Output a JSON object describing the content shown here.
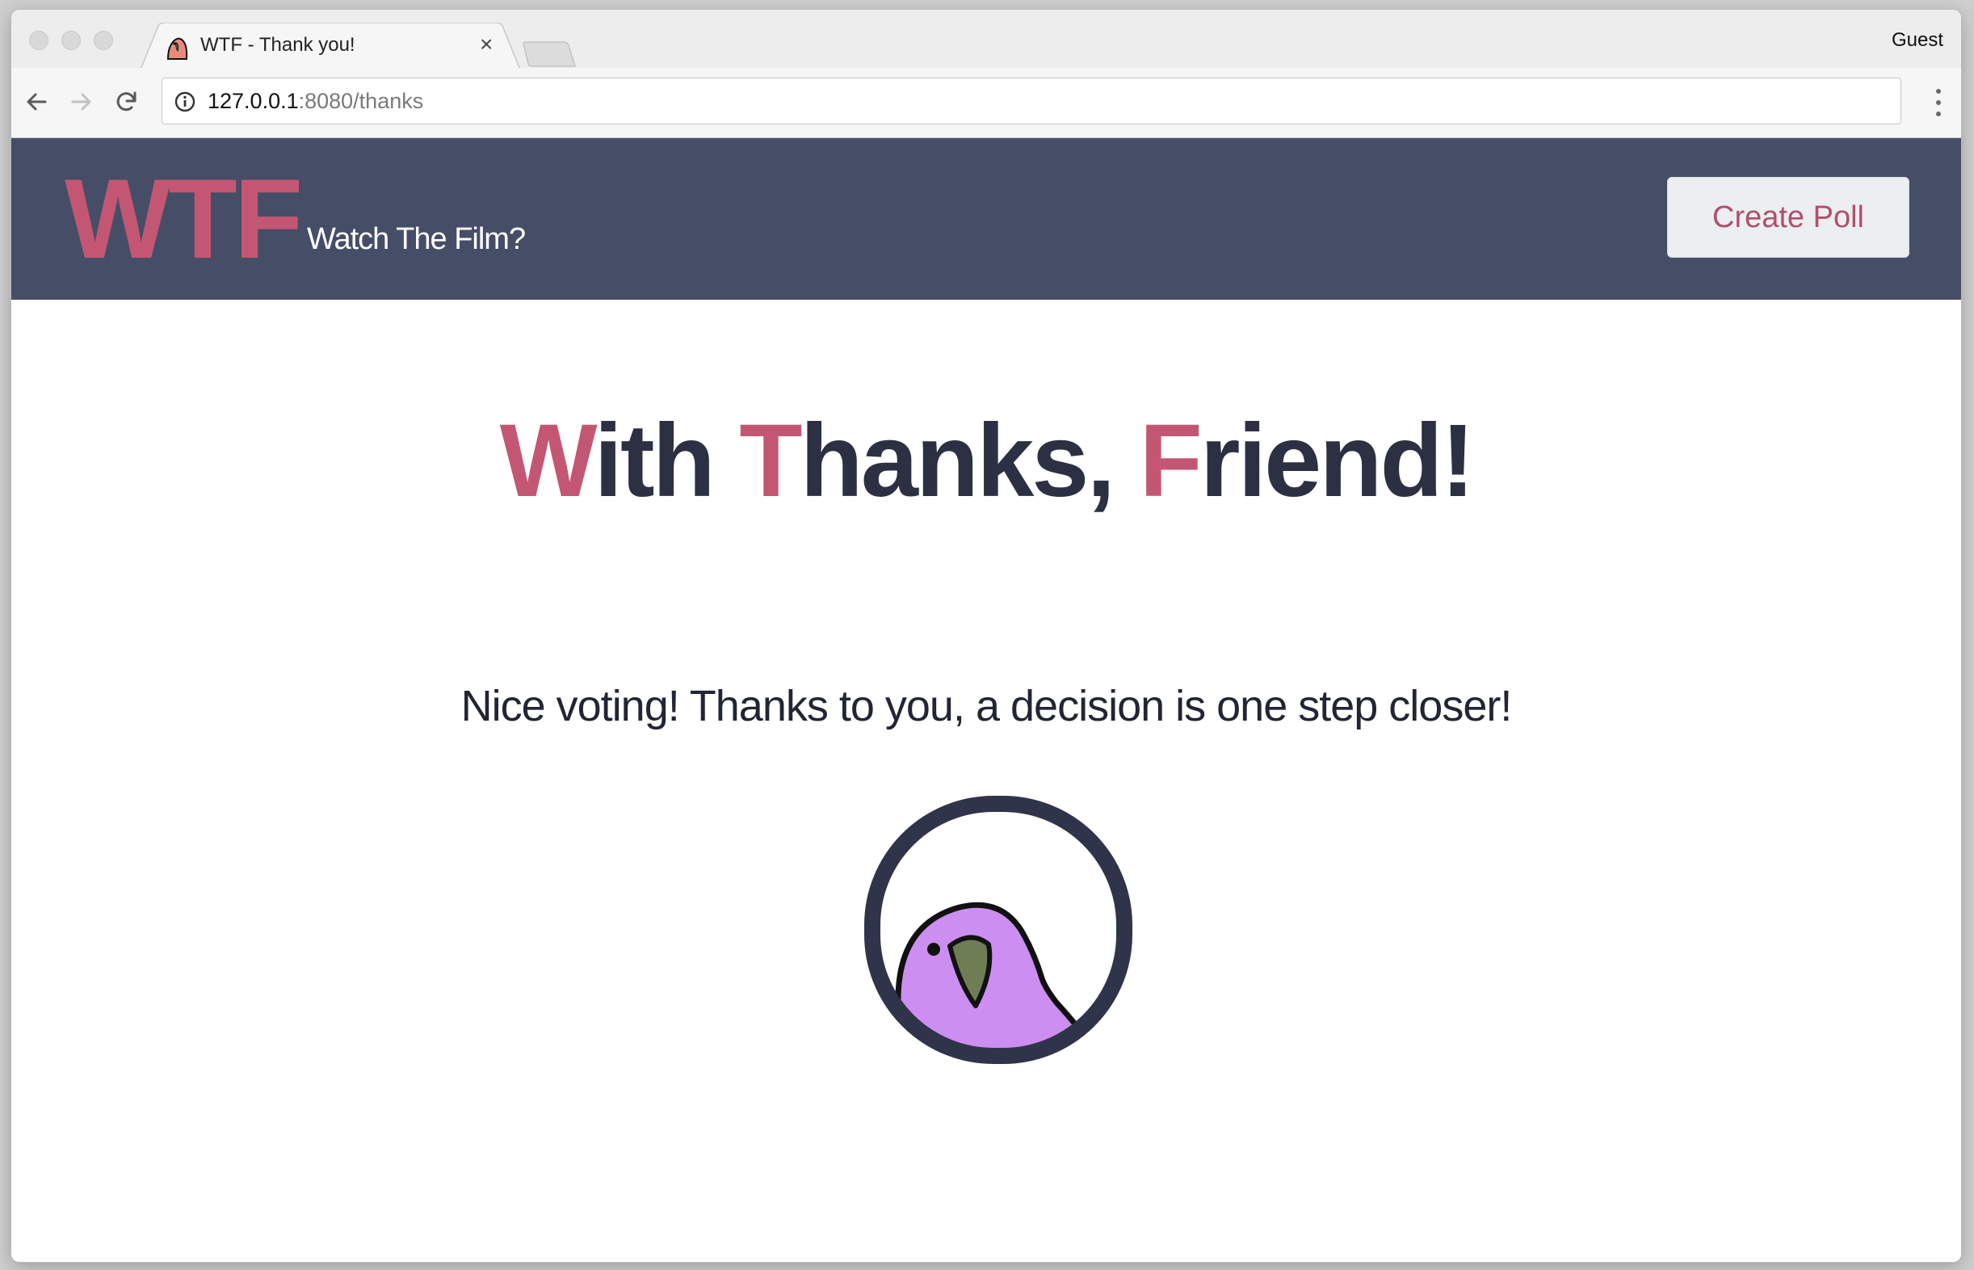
{
  "browser": {
    "tab_title": "WTF - Thank you!",
    "tab_close": "×",
    "profile": "Guest",
    "url_host": "127.0.0.1",
    "url_rest": ":8080/thanks"
  },
  "header": {
    "logo": "WTF",
    "tagline": "Watch The Film?",
    "create_poll": "Create Poll"
  },
  "hero": {
    "title_parts": {
      "w": "W",
      "ith": "ith ",
      "t": "T",
      "hanks": "hanks, ",
      "f": "F",
      "riend": "riend!"
    },
    "subtitle": "Nice voting! Thanks to you, a decision is one step closer!"
  },
  "colors": {
    "brand_pink": "#c35773",
    "header_bg": "#464d67",
    "dark_text": "#2d3043",
    "parrot": "#cc8ef0"
  },
  "icons": [
    "back-arrow-icon",
    "forward-arrow-icon",
    "reload-icon",
    "info-icon",
    "menu-dots-icon",
    "parrot-favicon-icon",
    "party-parrot-image"
  ]
}
